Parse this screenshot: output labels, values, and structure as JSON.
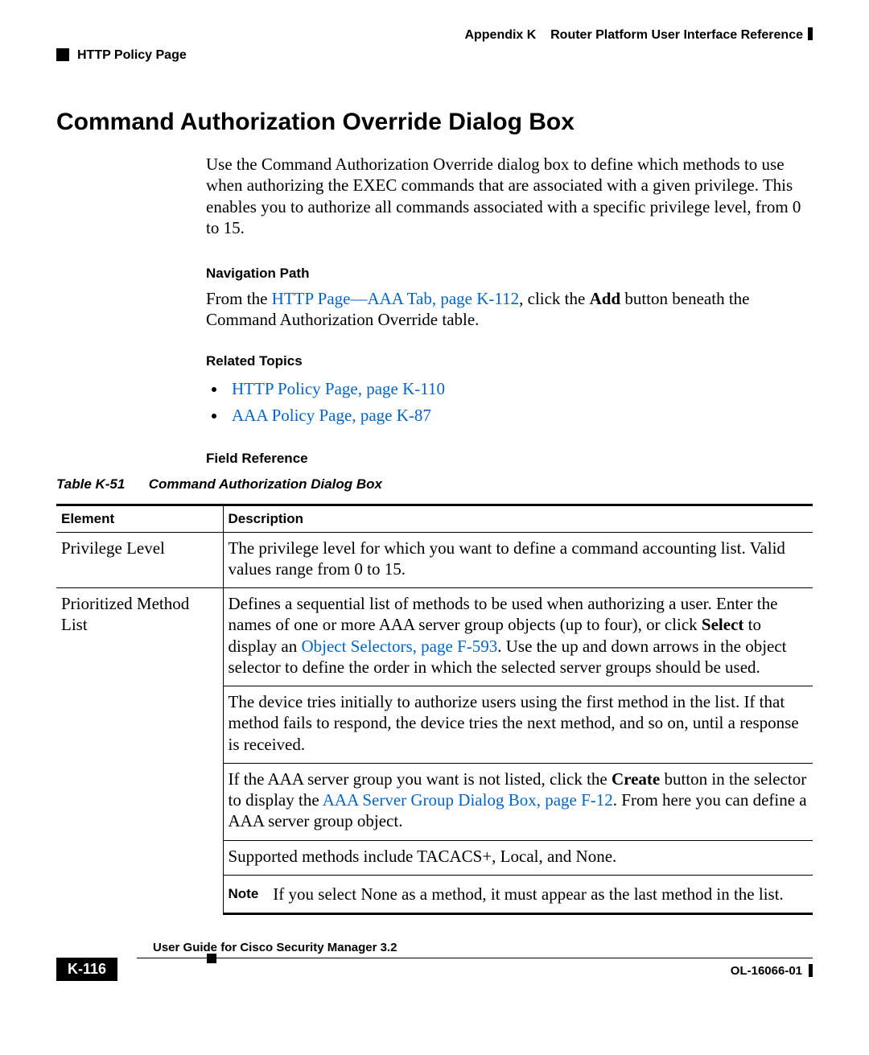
{
  "header": {
    "appendix_label": "Appendix K",
    "appendix_title": "Router Platform User Interface Reference",
    "section_breadcrumb": "HTTP Policy Page"
  },
  "title": "Command Authorization Override Dialog Box",
  "intro": "Use the Command Authorization Override dialog box to define which methods to use when authorizing the EXEC commands that are associated with a given privilege. This enables you to authorize all commands associated with a specific privilege level, from 0 to 15.",
  "nav": {
    "heading": "Navigation Path",
    "pre": "From the ",
    "link": "HTTP Page—AAA Tab, page K-112",
    "mid": ", click the ",
    "bold": "Add",
    "post": " button beneath the Command Authorization Override table."
  },
  "related": {
    "heading": "Related Topics",
    "items": [
      "HTTP Policy Page, page K-110",
      "AAA Policy Page, page K-87"
    ]
  },
  "field_ref_heading": "Field Reference",
  "table_caption": {
    "num": "Table K-51",
    "title": "Command Authorization Dialog Box"
  },
  "table": {
    "headers": {
      "c1": "Element",
      "c2": "Description"
    },
    "row1": {
      "element": "Privilege Level",
      "desc": "The privilege level for which you want to define a command accounting list. Valid values range from 0 to 15."
    },
    "row2": {
      "element": "Prioritized Method List",
      "p1_pre": "Defines a sequential list of methods to be used when authorizing a user. Enter the names of one or more AAA server group objects (up to four), or click ",
      "p1_bold": "Select",
      "p1_mid": " to display an ",
      "p1_link": "Object Selectors, page F-593",
      "p1_post": ". Use the up and down arrows in the object selector to define the order in which the selected server groups should be used.",
      "p2": "The device tries initially to authorize users using the first method in the list. If that method fails to respond, the device tries the next method, and so on, until a response is received.",
      "p3_pre": "If the AAA server group you want is not listed, click the ",
      "p3_bold": "Create",
      "p3_mid": " button in the selector to display the ",
      "p3_link": "AAA Server Group Dialog Box, page F-12",
      "p3_post": ". From here you can define a AAA server group object.",
      "p4": "Supported methods include TACACS+, Local, and None.",
      "note_label": "Note",
      "note_text": "If you select None as a method, it must appear as the last method in the list."
    }
  },
  "footer": {
    "guide": "User Guide for Cisco Security Manager 3.2",
    "page": "K-116",
    "doc": "OL-16066-01"
  }
}
